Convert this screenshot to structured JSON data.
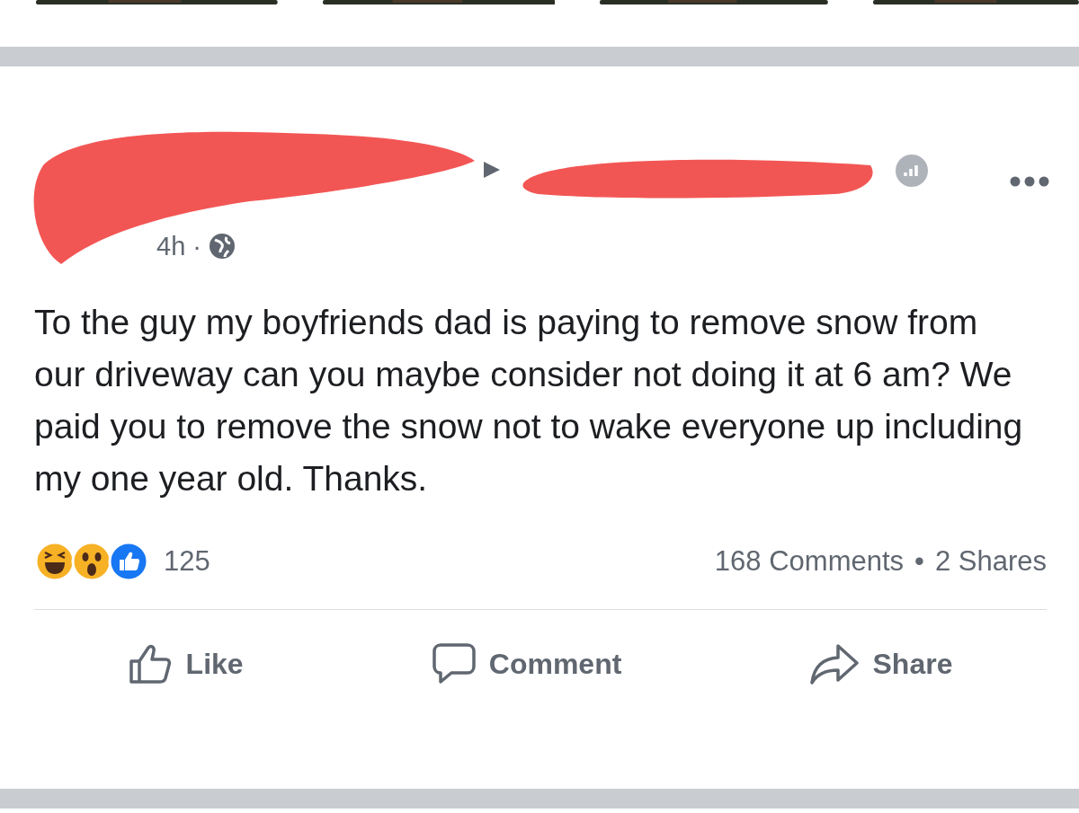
{
  "post": {
    "time": "4h",
    "time_separator": "·",
    "body": "To the guy my boyfriends dad is paying to remove snow from our driveway can you maybe consider not doing it at 6 am? We paid you to remove the snow not to wake everyone up including my one year old. Thanks.",
    "reaction_count": "125",
    "comments": "168 Comments",
    "stats_separator": "•",
    "shares": "2 Shares",
    "actions": [
      {
        "kind": "like",
        "label": "Like"
      },
      {
        "kind": "comment",
        "label": "Comment"
      },
      {
        "kind": "share",
        "label": "Share"
      }
    ]
  }
}
